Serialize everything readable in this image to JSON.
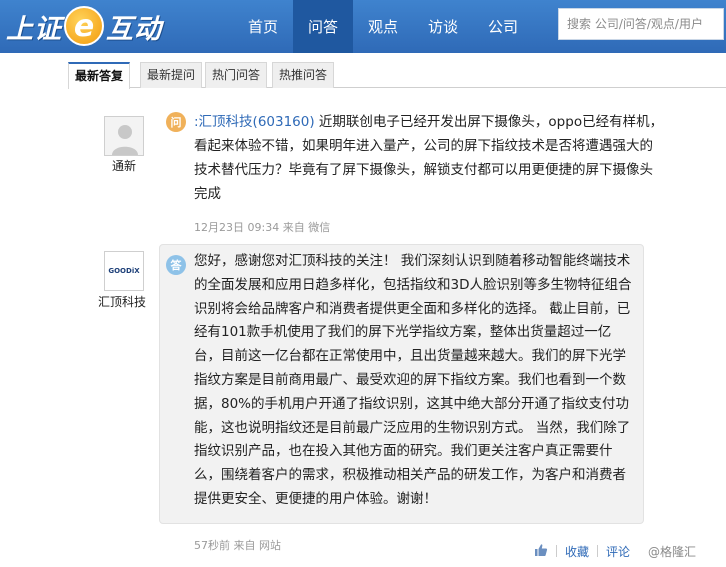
{
  "header": {
    "logo_left": "上证",
    "logo_e": "e",
    "logo_right": "互动",
    "nav": [
      "首页",
      "问答",
      "观点",
      "访谈",
      "公司"
    ],
    "active_nav": "问答",
    "search_placeholder": "搜索 公司/问答/观点/用户"
  },
  "tabs": [
    "最新答复",
    "最新提问",
    "热门问答",
    "热推问答"
  ],
  "question": {
    "asker_name": "通新",
    "badge": "问",
    "company_link": ":汇顶科技(603160)",
    "text": " 近期联创电子已经开发出屏下摄像头，oppo已经有样机，看起来体验不错，如果明年进入量产，公司的屏下指纹技术是否将遭遇强大的技术替代压力？毕竟有了屏下摄像头，解锁支付都可以用更便捷的屏下摄像头完成",
    "time": "12月23日 09:34",
    "source": "来自 微信"
  },
  "answer": {
    "company_name": "汇顶科技",
    "company_logo_text": "GOODiX",
    "badge": "答",
    "text": "您好，感谢您对汇顶科技的关注！ 我们深刻认识到随着移动智能终端技术的全面发展和应用日趋多样化，包括指纹和3D人脸识别等多生物特征组合识别将会给品牌客户和消费者提供更全面和多样化的选择。 截止目前，已经有101款手机使用了我们的屏下光学指纹方案，整体出货量超过一亿台，目前这一亿台都在正常使用中，且出货量越来越大。我们的屏下光学指纹方案是目前商用最广、最受欢迎的屏下指纹方案。我们也看到一个数据，80%的手机用户开通了指纹识别，这其中绝大部分开通了指纹支付功能，这也说明指纹还是目前最广泛应用的生物识别方式。 当然，我们除了指纹识别产品，也在投入其他方面的研究。我们更关注客户真正需要什么，围绕着客户的需求，积极推动相关产品的研发工作，为客户和消费者提供更安全、更便捷的用户体验。谢谢！",
    "time": "57秒前",
    "source": "来自 网站"
  },
  "actions": {
    "like_icon": "thumbs-up-icon",
    "favorite": "收藏",
    "comment": "评论"
  },
  "watermark": "@格隆汇"
}
